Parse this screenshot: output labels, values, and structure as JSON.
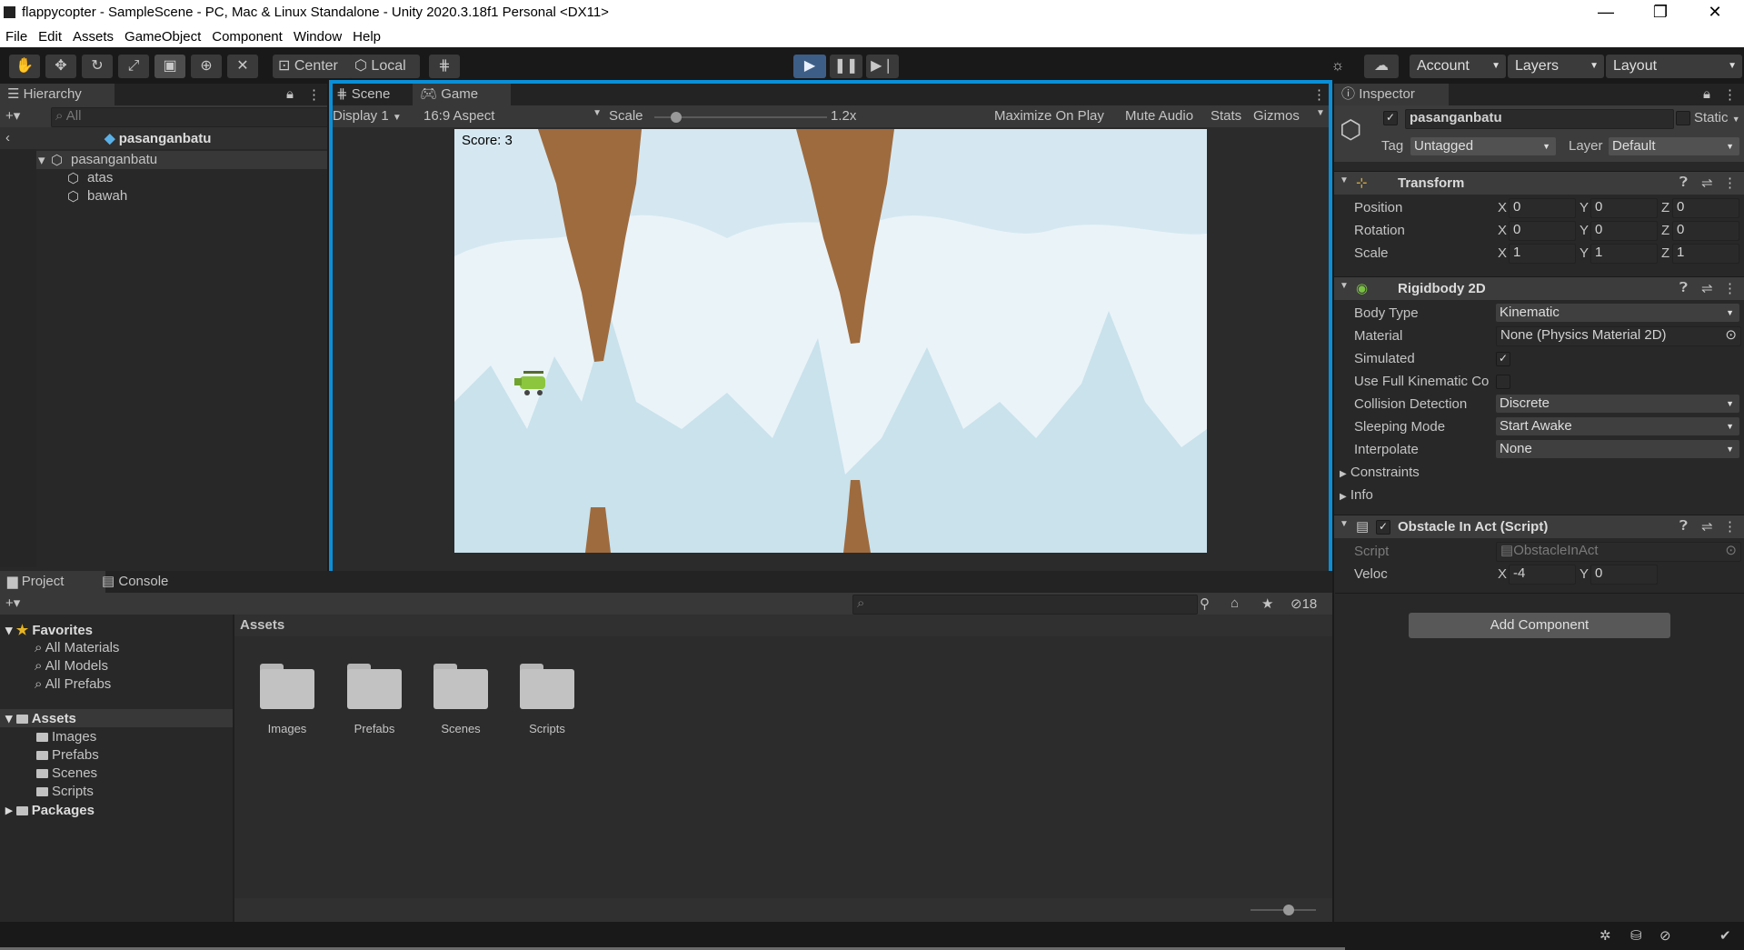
{
  "window": {
    "title": "flappycopter - SampleScene - PC, Mac & Linux Standalone - Unity 2020.3.18f1 Personal <DX11>",
    "minimize": "—",
    "maximize": "❐",
    "close": "✕"
  },
  "menu": [
    "File",
    "Edit",
    "Assets",
    "GameObject",
    "Component",
    "Window",
    "Help"
  ],
  "toolbar": {
    "center_label": "Center",
    "local_label": "Local",
    "account_label": "Account",
    "layers_label": "Layers",
    "layout_label": "Layout"
  },
  "hierarchy": {
    "tab": "Hierarchy",
    "search_placeholder": "All",
    "breadcrumb": "pasanganbatu",
    "root": "pasanganbatu",
    "children": [
      "atas",
      "bawah"
    ]
  },
  "scene_tabs": {
    "scene": "Scene",
    "game": "Game"
  },
  "game_view": {
    "display": "Display 1",
    "aspect": "16:9 Aspect",
    "scale_label": "Scale",
    "scale_value": "1.2x",
    "scale_fraction": 0.1,
    "maximize": "Maximize On Play",
    "mute": "Mute Audio",
    "stats": "Stats",
    "gizmos": "Gizmos",
    "score": "Score: 3"
  },
  "project": {
    "tab_project": "Project",
    "tab_console": "Console",
    "favorites_label": "Favorites",
    "favorites": [
      "All Materials",
      "All Models",
      "All Prefabs"
    ],
    "assets_label": "Assets",
    "asset_folders": [
      "Images",
      "Prefabs",
      "Scenes",
      "Scripts"
    ],
    "packages_label": "Packages",
    "breadcrumb": "Assets",
    "hidden_count": "18",
    "grid_folders": [
      "Images",
      "Prefabs",
      "Scenes",
      "Scripts"
    ]
  },
  "inspector": {
    "tab": "Inspector",
    "object_name": "pasanganbatu",
    "static_label": "Static",
    "tag_label": "Tag",
    "tag_value": "Untagged",
    "layer_label": "Layer",
    "layer_value": "Default",
    "transform": {
      "title": "Transform",
      "rows": [
        {
          "label": "Position",
          "x": "0",
          "y": "0",
          "z": "0"
        },
        {
          "label": "Rotation",
          "x": "0",
          "y": "0",
          "z": "0"
        },
        {
          "label": "Scale",
          "x": "1",
          "y": "1",
          "z": "1"
        }
      ]
    },
    "rigidbody": {
      "title": "Rigidbody 2D",
      "body_type_label": "Body Type",
      "body_type": "Kinematic",
      "material_label": "Material",
      "material": "None (Physics Material 2D)",
      "simulated_label": "Simulated",
      "full_kinematic_label": "Use Full Kinematic Co",
      "collision_label": "Collision Detection",
      "collision": "Discrete",
      "sleeping_label": "Sleeping Mode",
      "sleeping": "Start Awake",
      "interpolate_label": "Interpolate",
      "interpolate": "None",
      "constraints_label": "Constraints",
      "info_label": "Info"
    },
    "script": {
      "title": "Obstacle In Act (Script)",
      "script_label": "Script",
      "script_value": "ObstacleInAct",
      "veloc_label": "Veloc",
      "veloc_x": "-4",
      "veloc_y": "0"
    },
    "add_component": "Add Component"
  },
  "axis": {
    "x": "X",
    "y": "Y",
    "z": "Z"
  },
  "colors": {
    "accent": "#0a8fd8",
    "sky": "#dcebf3",
    "rock": "#9e6b3f",
    "play_blue": "#4c88c8"
  }
}
